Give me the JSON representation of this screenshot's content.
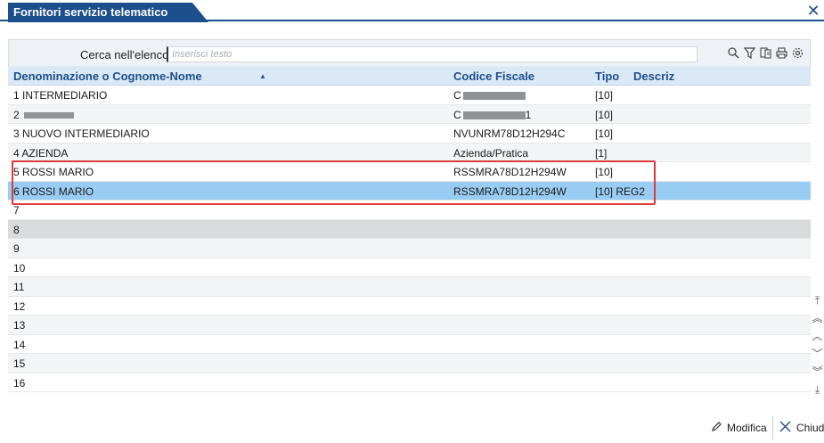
{
  "window": {
    "title": "Fornitori servizio telematico"
  },
  "search": {
    "label": "Cerca nell'elenco",
    "placeholder": "Inserisci testo"
  },
  "toolbar": {
    "icons": [
      "search-icon",
      "filter-icon",
      "export-icon",
      "print-icon",
      "settings-icon"
    ]
  },
  "table": {
    "columns": [
      "Denominazione o Cognome-Nome",
      "Codice Fiscale",
      "Tipo",
      "Descriz"
    ],
    "rows": [
      {
        "num": "1",
        "name": "INTERMEDIARIO",
        "cf": "C",
        "tipo": "[10]",
        "descr": ""
      },
      {
        "num": "2",
        "name": "",
        "cf": "C",
        "cf_suffix": "1",
        "tipo": "[10]",
        "descr": ""
      },
      {
        "num": "3",
        "name": "NUOVO INTERMEDIARIO",
        "cf": "NVUNRM78D12H294C",
        "tipo": "[10]",
        "descr": ""
      },
      {
        "num": "4",
        "name": "AZIENDA",
        "cf": "Azienda/Pratica",
        "tipo": "[1]",
        "descr": ""
      },
      {
        "num": "5",
        "name": "ROSSI MARIO",
        "cf": "RSSMRA78D12H294W",
        "tipo": "[10]",
        "descr": ""
      },
      {
        "num": "6",
        "name": "ROSSI MARIO",
        "cf": "RSSMRA78D12H294W",
        "tipo": "[10]",
        "descr": "REG2"
      },
      {
        "num": "7"
      },
      {
        "num": "8"
      },
      {
        "num": "9"
      },
      {
        "num": "10"
      },
      {
        "num": "11"
      },
      {
        "num": "12"
      },
      {
        "num": "13"
      },
      {
        "num": "14"
      },
      {
        "num": "15"
      },
      {
        "num": "16"
      }
    ]
  },
  "footer": {
    "modify_label": "Modifica",
    "close_label": "Chiud"
  },
  "colors": {
    "accent": "#1d4f8c",
    "header_bg": "#dbe9f6",
    "selected": "#99ccf2",
    "highlight": "#e0393e"
  }
}
